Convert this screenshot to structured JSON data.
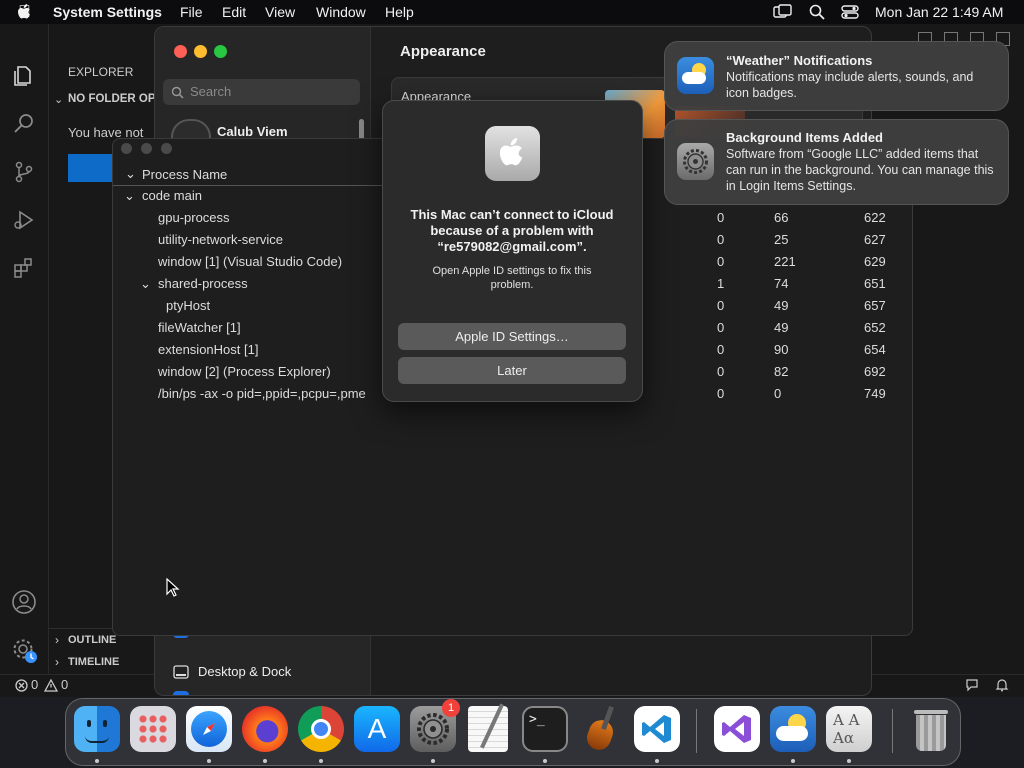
{
  "menubar": {
    "app_name": "System Settings",
    "menus": [
      "File",
      "Edit",
      "View",
      "Window",
      "Help"
    ],
    "datetime": "Mon Jan 22  1:49 AM"
  },
  "vscode": {
    "explorer_header": "EXPLORER",
    "no_folder": "NO FOLDER OP",
    "you_have": "You have not",
    "outline": "OUTLINE",
    "timeline": "TIMELINE",
    "status_errors": "0",
    "status_warnings": "0"
  },
  "settings": {
    "search_placeholder": "Search",
    "user_name": "Calub Viem",
    "pane_title": "Appearance",
    "appearance_label": "Appearance",
    "desktop_dock": "Desktop & Dock"
  },
  "process_explorer": {
    "header": "Process Name",
    "rows": [
      {
        "name": "code main",
        "indent": 1,
        "chev": "v",
        "cpu": "",
        "mem": "",
        "pid": ""
      },
      {
        "name": "gpu-process",
        "indent": 2,
        "chev": "",
        "cpu": "0",
        "mem": "66",
        "pid": "622"
      },
      {
        "name": "utility-network-service",
        "indent": 2,
        "chev": "",
        "cpu": "0",
        "mem": "25",
        "pid": "627"
      },
      {
        "name": "window [1] (Visual Studio Code)",
        "indent": 2,
        "chev": "",
        "cpu": "0",
        "mem": "221",
        "pid": "629"
      },
      {
        "name": "shared-process",
        "indent": 2,
        "chev": "v",
        "cpu": "1",
        "mem": "74",
        "pid": "651"
      },
      {
        "name": "ptyHost",
        "indent": 3,
        "chev": "",
        "cpu": "0",
        "mem": "49",
        "pid": "657"
      },
      {
        "name": "fileWatcher [1]",
        "indent": 2,
        "chev": "",
        "cpu": "0",
        "mem": "49",
        "pid": "652"
      },
      {
        "name": "extensionHost [1]",
        "indent": 2,
        "chev": "",
        "cpu": "0",
        "mem": "90",
        "pid": "654"
      },
      {
        "name": "window [2] (Process Explorer)",
        "indent": 2,
        "chev": "",
        "cpu": "0",
        "mem": "82",
        "pid": "692"
      },
      {
        "name": "/bin/ps -ax -o pid=,ppid=,pcpu=,pme",
        "indent": 2,
        "chev": "",
        "cpu": "0",
        "mem": "0",
        "pid": "749"
      }
    ]
  },
  "dialog": {
    "message": "This Mac can’t connect to iCloud because of a problem with “re579082@gmail.com”.",
    "info": "Open Apple ID settings to fix this problem.",
    "primary_button": "Apple ID Settings…",
    "secondary_button": "Later"
  },
  "notifications": [
    {
      "title": "“Weather” Notifications",
      "body": "Notifications may include alerts, sounds, and icon badges.",
      "icon": "weather-icon"
    },
    {
      "title": "Background Items Added",
      "body": "Software from “Google LLC” added items that can run in the background. You can manage this in Login Items Settings.",
      "icon": "settings-gear-icon"
    }
  ],
  "dock": {
    "badge": "1",
    "apps": [
      "finder",
      "launchpad",
      "safari",
      "firefox",
      "chrome",
      "app-store",
      "system-settings",
      "textedit",
      "terminal",
      "garageband",
      "vscode",
      "visual-studio",
      "weather",
      "font-book",
      "trash"
    ]
  }
}
